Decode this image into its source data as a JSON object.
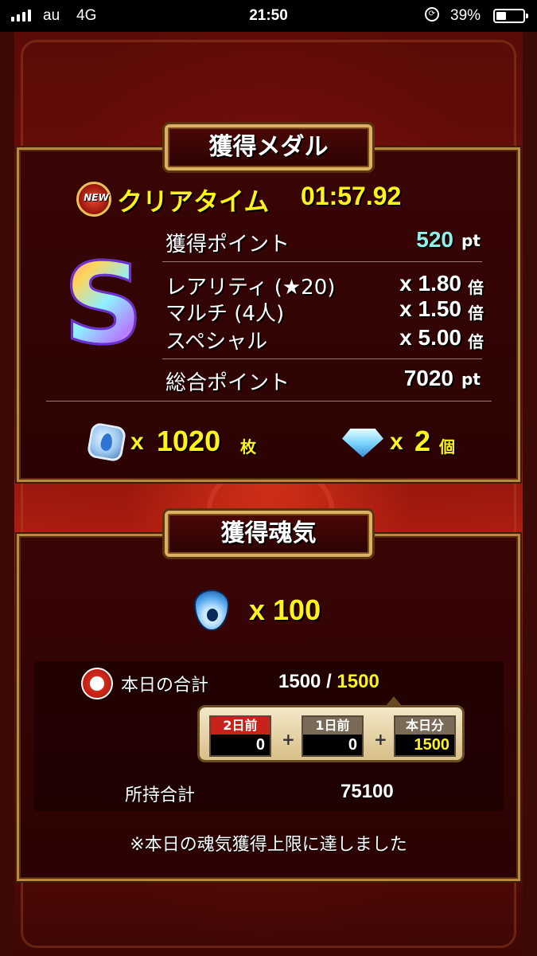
{
  "status_bar": {
    "carrier": "au",
    "network": "4G",
    "time": "21:50",
    "battery_percent": "39%",
    "battery_level": 0.39,
    "signal_bars": 4
  },
  "medal_panel": {
    "title": "獲得メダル",
    "new_badge": "NEW",
    "clear_time_label": "クリアタイム",
    "clear_time": "01:57.92",
    "rank": "S",
    "earned_points_label": "獲得ポイント",
    "earned_points_value": "520",
    "earned_points_unit": "pt",
    "multipliers": [
      {
        "label": "レアリティ (★20)",
        "value": "x 1.80",
        "unit": "倍"
      },
      {
        "label": "マルチ (4人)",
        "value": "x 1.50",
        "unit": "倍"
      },
      {
        "label": "スペシャル",
        "value": "x 5.00",
        "unit": "倍"
      }
    ],
    "total_points_label": "総合ポイント",
    "total_points_value": "7020",
    "total_points_unit": "pt",
    "medals_x": "x",
    "medals_count": "1020",
    "medals_unit": "枚",
    "gems_x": "x",
    "gems_count": "2",
    "gems_unit": "個"
  },
  "soul_panel": {
    "title": "獲得魂気",
    "soul_gain": "x 100",
    "today_label": "本日の合計",
    "today_current": "1500",
    "today_separator": "/",
    "today_max": "1500",
    "breakdown": [
      {
        "label": "2日前",
        "value": "0"
      },
      {
        "label": "1日前",
        "value": "0"
      },
      {
        "label": "本日分",
        "value": "1500"
      }
    ],
    "plus": "+",
    "owned_label": "所持合計",
    "owned_value": "75100",
    "notice": "※本日の魂気獲得上限に達しました"
  }
}
